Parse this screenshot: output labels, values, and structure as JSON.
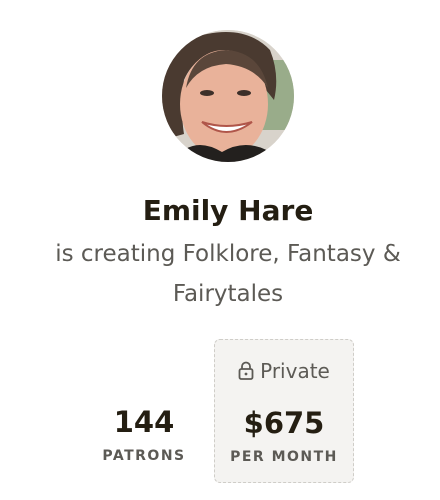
{
  "creator": {
    "name": "Emily Hare",
    "tagline": "is creating Folklore, Fantasy & Fairytales"
  },
  "stats": {
    "patrons_value": "144",
    "patrons_label": "PATRONS",
    "income_value": "$675",
    "income_label": "PER MONTH",
    "privacy_label": "Private"
  },
  "icons": {
    "privacy": "lock-icon"
  },
  "colors": {
    "text_primary": "#241e12",
    "text_secondary": "#5c5a55",
    "private_box_bg": "#f4f3f1",
    "private_box_border": "#cfcdc8"
  }
}
